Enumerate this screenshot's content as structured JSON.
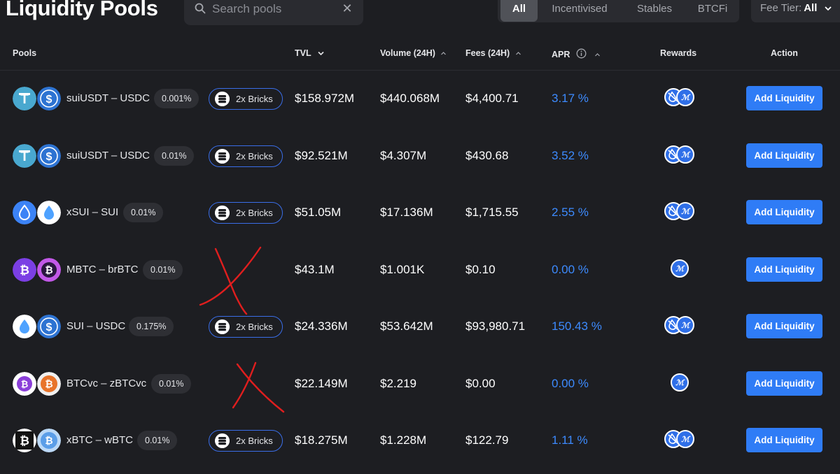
{
  "header": {
    "title": "Liquidity Pools",
    "search_placeholder": "Search pools",
    "filter_tabs": [
      "All",
      "Incentivised",
      "Stables",
      "BTCFi"
    ],
    "active_tab": "All",
    "fee_tier_label": "Fee Tier:",
    "fee_tier_value": "All"
  },
  "columns": {
    "pools": "Pools",
    "tvl": "TVL",
    "volume": "Volume (24H)",
    "fees": "Fees (24H)",
    "apr": "APR",
    "rewards": "Rewards",
    "action": "Action"
  },
  "colors": {
    "background": "#1d1e22",
    "accent": "#2f7cf6",
    "apr_text": "#3d8bff",
    "annotation": "#e01e1e"
  },
  "rows": [
    {
      "pair": "suiUSDT – USDC",
      "fee_tier": "0.001%",
      "bricks": "2x Bricks",
      "tvl": "$158.972M",
      "volume": "$440.068M",
      "fees": "$4,400.71",
      "apr": "3.17 %",
      "action": "Add Liquidity",
      "coins": [
        "usdt-icon",
        "usdc-icon"
      ],
      "rewards": [
        "drop-reward-icon",
        "points-reward-icon"
      ]
    },
    {
      "pair": "suiUSDT – USDC",
      "fee_tier": "0.01%",
      "bricks": "2x Bricks",
      "tvl": "$92.521M",
      "volume": "$4.307M",
      "fees": "$430.68",
      "apr": "3.52 %",
      "action": "Add Liquidity",
      "coins": [
        "usdt-icon",
        "usdc-icon"
      ],
      "rewards": [
        "drop-reward-icon",
        "points-reward-icon"
      ]
    },
    {
      "pair": "xSUI – SUI",
      "fee_tier": "0.01%",
      "bricks": "2x Bricks",
      "tvl": "$51.05M",
      "volume": "$17.136M",
      "fees": "$1,715.55",
      "apr": "2.55 %",
      "action": "Add Liquidity",
      "coins": [
        "xsui-icon",
        "sui-icon"
      ],
      "rewards": [
        "drop-reward-icon",
        "points-reward-icon"
      ]
    },
    {
      "pair": "MBTC – brBTC",
      "fee_tier": "0.01%",
      "bricks": "",
      "tvl": "$43.1M",
      "volume": "$1.001K",
      "fees": "$0.10",
      "apr": "0.00 %",
      "action": "Add Liquidity",
      "coins": [
        "mbtc-icon",
        "brbtc-icon"
      ],
      "rewards": [
        "points-reward-icon"
      ]
    },
    {
      "pair": "SUI – USDC",
      "fee_tier": "0.175%",
      "bricks": "2x Bricks",
      "tvl": "$24.336M",
      "volume": "$53.642M",
      "fees": "$93,980.71",
      "apr": "150.43 %",
      "action": "Add Liquidity",
      "coins": [
        "sui-icon",
        "usdc-icon"
      ],
      "rewards": [
        "drop-reward-icon",
        "points-reward-icon"
      ]
    },
    {
      "pair": "BTCvc – zBTCvc",
      "fee_tier": "0.01%",
      "bricks": "",
      "tvl": "$22.149M",
      "volume": "$2.219",
      "fees": "$0.00",
      "apr": "0.00 %",
      "action": "Add Liquidity",
      "coins": [
        "btcvc-icon",
        "zbtcvc-icon"
      ],
      "rewards": [
        "points-reward-icon"
      ]
    },
    {
      "pair": "xBTC – wBTC",
      "fee_tier": "0.01%",
      "bricks": "2x Bricks",
      "tvl": "$18.275M",
      "volume": "$1.228M",
      "fees": "$122.79",
      "apr": "1.11 %",
      "action": "Add Liquidity",
      "coins": [
        "xbtc-icon",
        "wbtc-icon"
      ],
      "rewards": [
        "drop-reward-icon",
        "points-reward-icon"
      ]
    }
  ]
}
